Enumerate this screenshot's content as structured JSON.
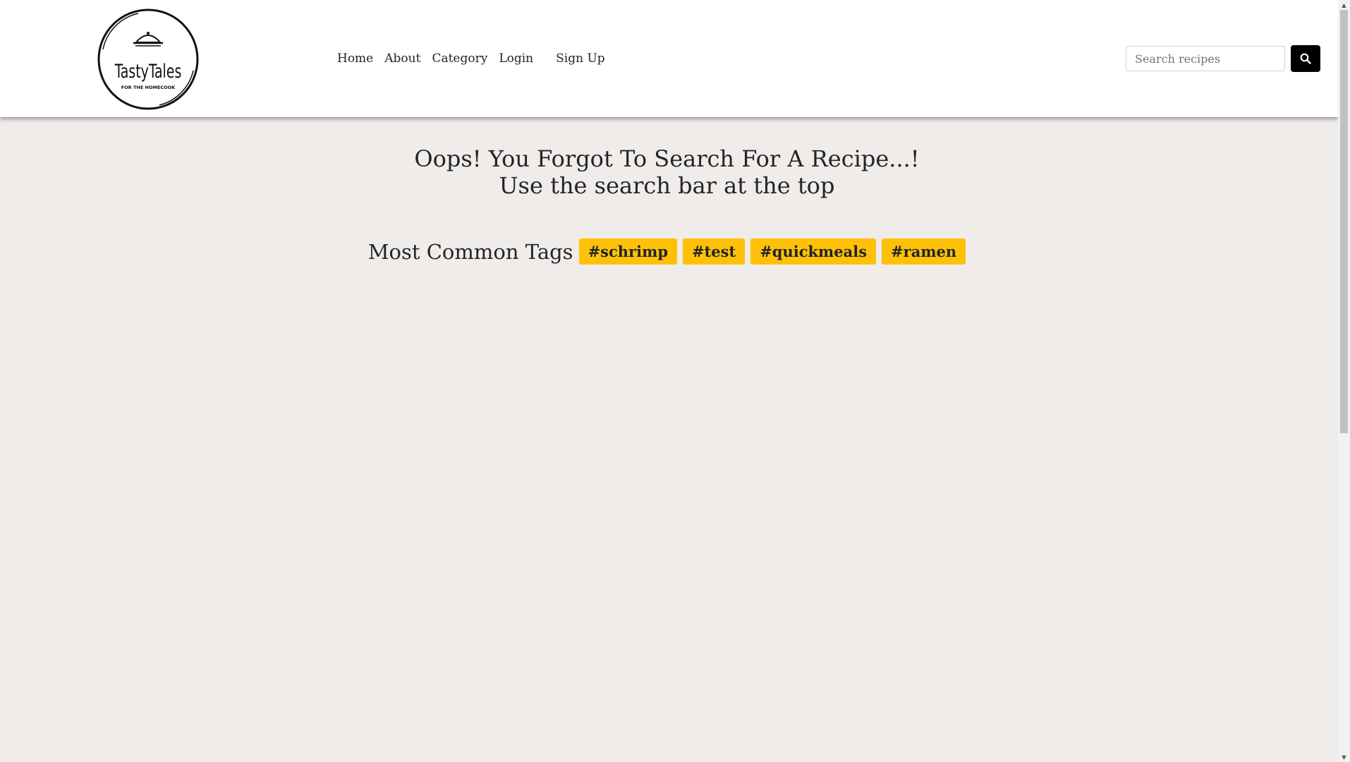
{
  "brand": {
    "logo_text": "TastyTales",
    "logo_subtext": "FOR THE HOMECOOK"
  },
  "nav": {
    "items": [
      {
        "label": "Home"
      },
      {
        "label": "About"
      },
      {
        "label": "Category"
      },
      {
        "label": "Login"
      },
      {
        "label": "Sign Up"
      }
    ]
  },
  "search": {
    "placeholder": "Search recipes",
    "value": "",
    "button_icon": "search-icon"
  },
  "main": {
    "headline_line1": "Oops! You Forgot To Search For A Recipe...!",
    "headline_line2": "Use the search bar at the top",
    "tags_title": "Most Common Tags",
    "tags": [
      {
        "label": "#schrimp"
      },
      {
        "label": "#test"
      },
      {
        "label": "#quickmeals"
      },
      {
        "label": "#ramen"
      }
    ]
  },
  "colors": {
    "background": "#f0ecea",
    "navbar": "#ffffff",
    "tag": "#ffc107",
    "search_button": "#000000"
  }
}
